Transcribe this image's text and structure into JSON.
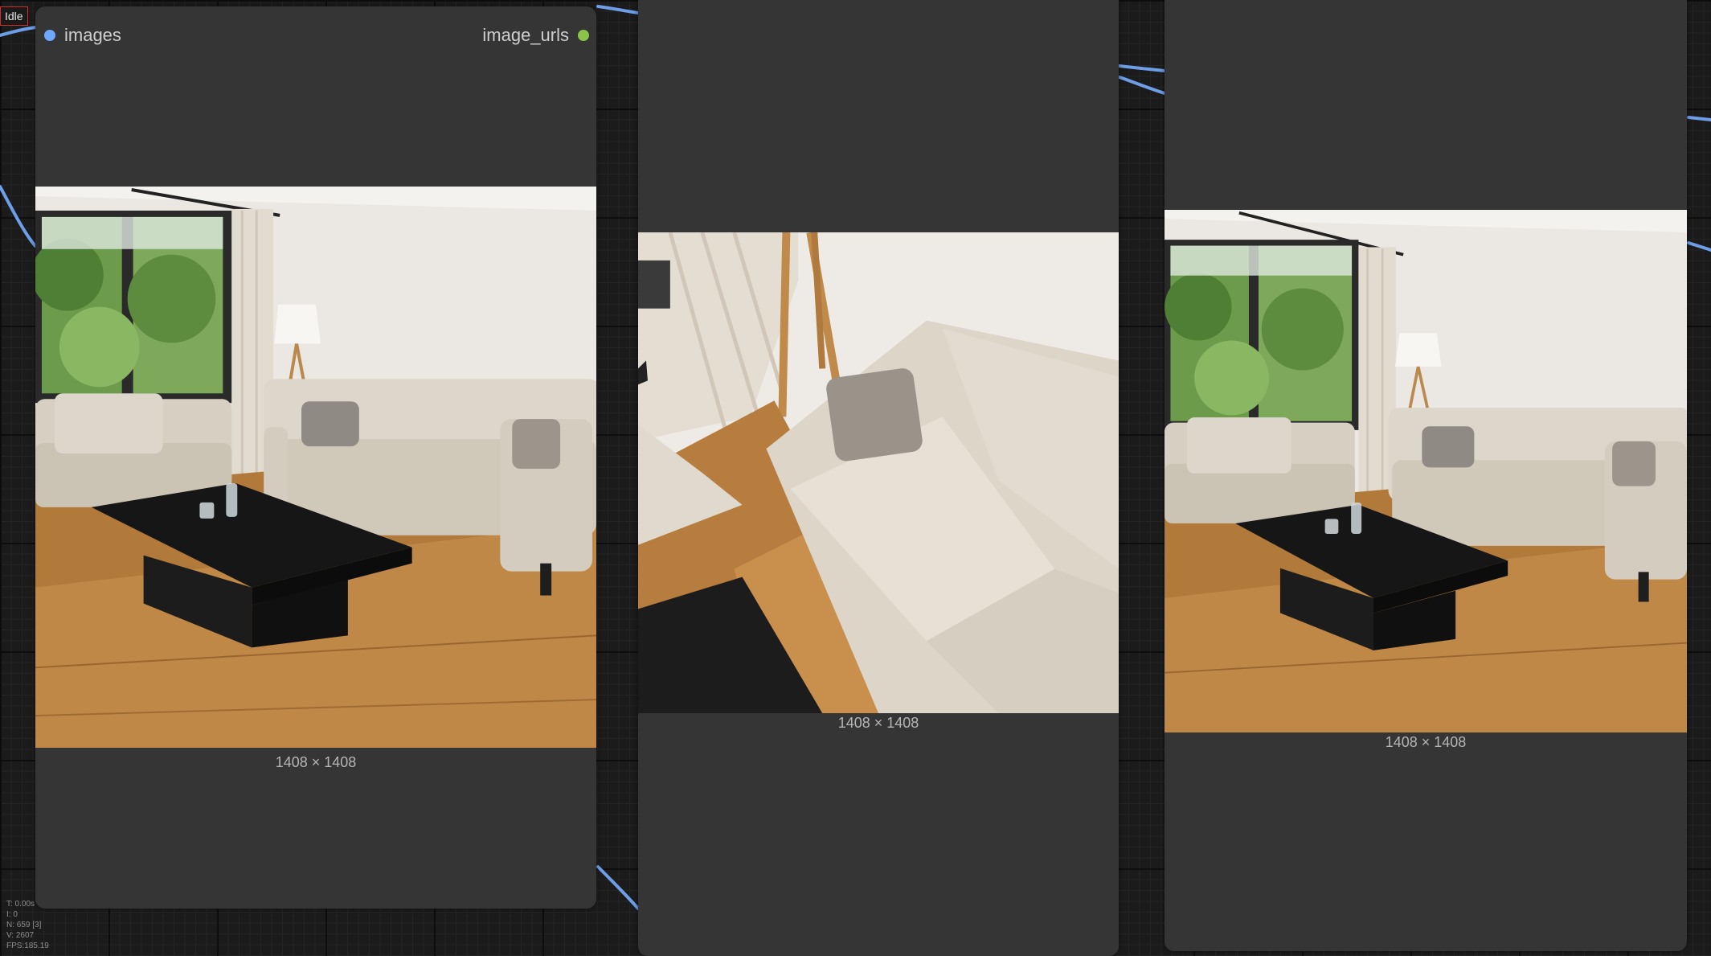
{
  "status": {
    "label": "Idle"
  },
  "nodes": {
    "left": {
      "input_label": "images",
      "output_label": "image_urls",
      "input_color": "#6ea8ff",
      "output_color": "#8bc34a",
      "dimensions": "1408 × 1408"
    },
    "middle": {
      "dimensions": "1408 × 1408"
    },
    "right": {
      "dimensions": "1408 × 1408"
    }
  },
  "images": {
    "left": "living room with two beige sofas, black coffee table, window with garden view and floor lamp",
    "middle": "close-up tilted view of beige sofa with grey cushion, curtain and wooden floor",
    "right": "living room with two beige sofas, black coffee table, window and floor lamp"
  },
  "stats": {
    "t": "T: 0.00s",
    "i": "I: 0",
    "n": "N: 659 [3]",
    "v": "V: 2607",
    "fps": "FPS:185.19"
  },
  "colors": {
    "link": "#6ea8ff",
    "node_bg": "#353535",
    "canvas_bg": "#1b1b1b"
  }
}
